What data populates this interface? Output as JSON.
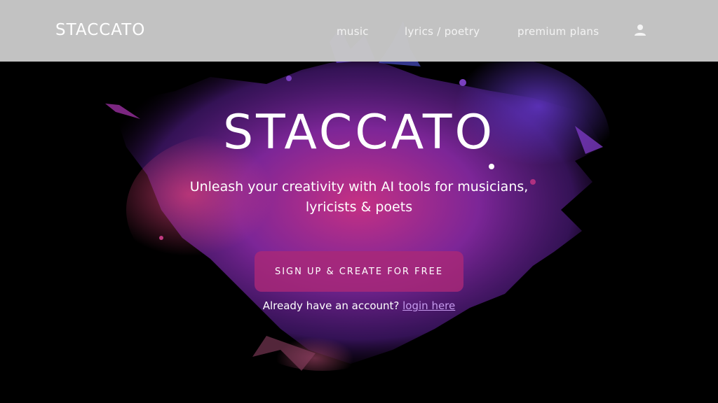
{
  "brand": {
    "logo_text": "STACCATO"
  },
  "nav": {
    "links": [
      {
        "label": "music"
      },
      {
        "label": "lyrics / poetry"
      },
      {
        "label": "premium plans"
      }
    ],
    "account_icon": "user-icon"
  },
  "hero": {
    "title": "STACCATO",
    "tagline": "Unleash your creativity with AI tools for musicians, lyricists & poets",
    "cta_label": "SIGN UP & CREATE FOR FREE",
    "login_prompt": "Already have an account?",
    "login_link": "login here"
  },
  "colors": {
    "background": "#000000",
    "navbar": "#c8c8c8",
    "cta": "#aa2878",
    "link": "#c79cf0",
    "splash_purple": "#7a2fb0",
    "splash_magenta": "#b0307a"
  }
}
